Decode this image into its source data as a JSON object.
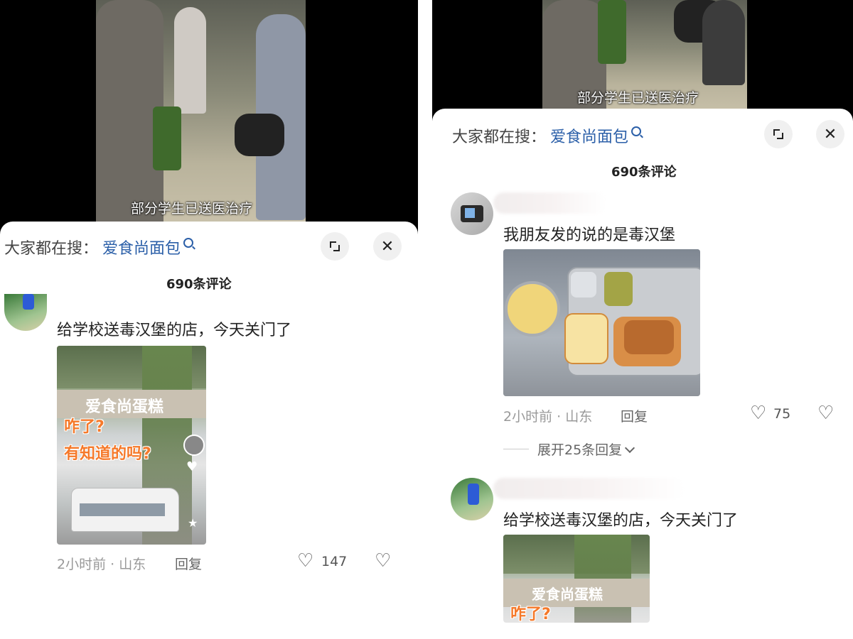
{
  "left": {
    "video_subtitle": "部分学生已送医治疗",
    "search_prefix": "大家都在搜：",
    "search_term": "爱食尚面包",
    "comment_count": "690条评论",
    "comment": {
      "text": "给学校送毒汉堡的店，今天关门了",
      "overlay_line1": "咋了?",
      "overlay_line2": "有知道的吗?",
      "shop_sign": "爱食尚蛋糕",
      "time_location": "2小时前 · 山东",
      "reply_label": "回复",
      "likes": "147"
    }
  },
  "right": {
    "video_subtitle": "部分学生已送医治疗",
    "search_prefix": "大家都在搜：",
    "search_term": "爱食尚面包",
    "comment_count": "690条评论",
    "comment1": {
      "text": "我朋友发的说的是毒汉堡",
      "time_location": "2小时前 · 山东",
      "reply_label": "回复",
      "likes": "75",
      "expand_replies": "展开25条回复"
    },
    "comment2": {
      "text": "给学校送毒汉堡的店，今天关门了",
      "overlay_line1": "咋了?",
      "shop_sign": "爱食尚蛋糕"
    }
  }
}
